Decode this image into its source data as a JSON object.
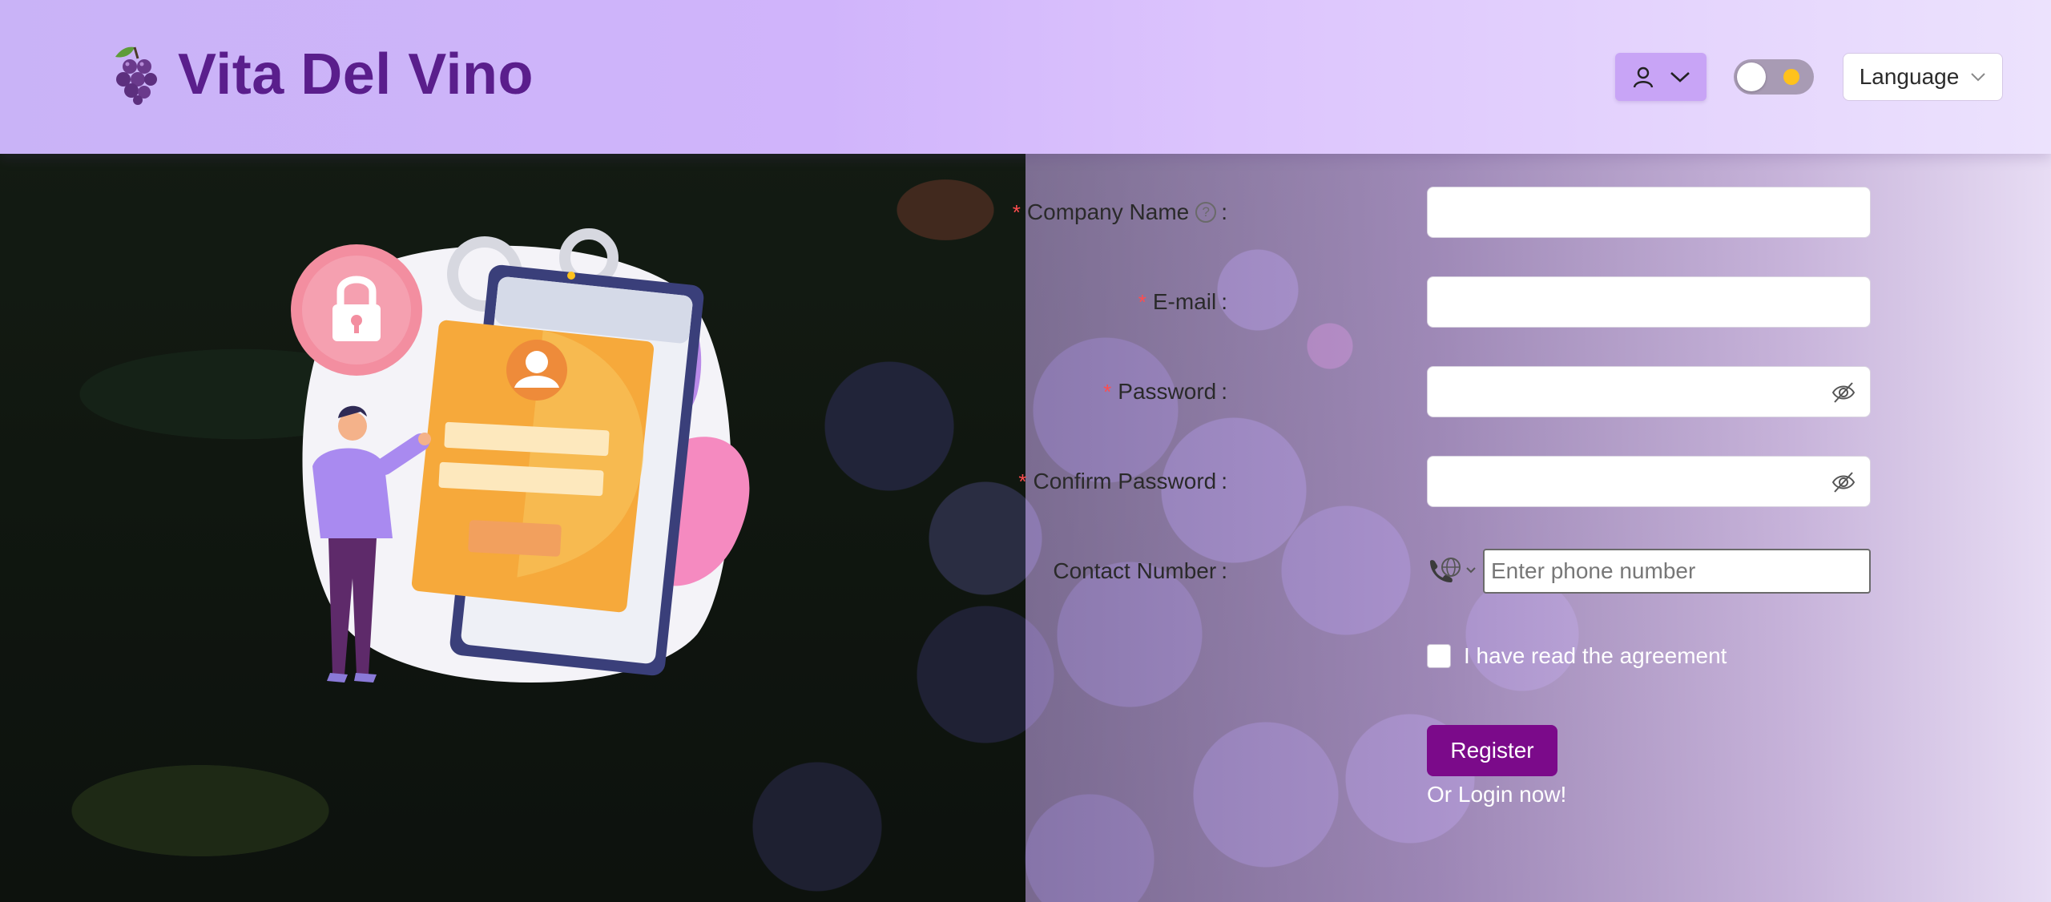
{
  "header": {
    "brand_name": "Vita Del Vino",
    "language_label": "Language"
  },
  "form": {
    "company_name": {
      "label": "Company Name",
      "required": true,
      "value": ""
    },
    "email": {
      "label": "E-mail",
      "required": true,
      "value": ""
    },
    "password": {
      "label": "Password",
      "required": true,
      "value": ""
    },
    "confirm_password": {
      "label": "Confirm Password",
      "required": true,
      "value": ""
    },
    "contact_number": {
      "label": "Contact Number",
      "placeholder": "Enter phone number",
      "value": ""
    },
    "required_mark": "*",
    "colon": ":",
    "help_symbol": "?",
    "agreement_label": "I have read the agreement",
    "agreement_checked": false,
    "register_label": "Register",
    "login_link": "Or Login now!"
  },
  "icons": {
    "brand": "grapes-icon",
    "user": "user-icon",
    "user_dropdown": "chevron-down-icon",
    "theme_toggle": "sun-icon",
    "language_dropdown": "chevron-down-icon",
    "password_visibility": "eye-off-icon",
    "phone_country": "globe-phone-icon"
  },
  "colors": {
    "brand_text": "#5a1e8c",
    "primary_button": "#7b0a8a",
    "required_mark": "#ff4d4f",
    "user_button": "#c8a4f6",
    "toggle_sun": "#ffc21c"
  }
}
